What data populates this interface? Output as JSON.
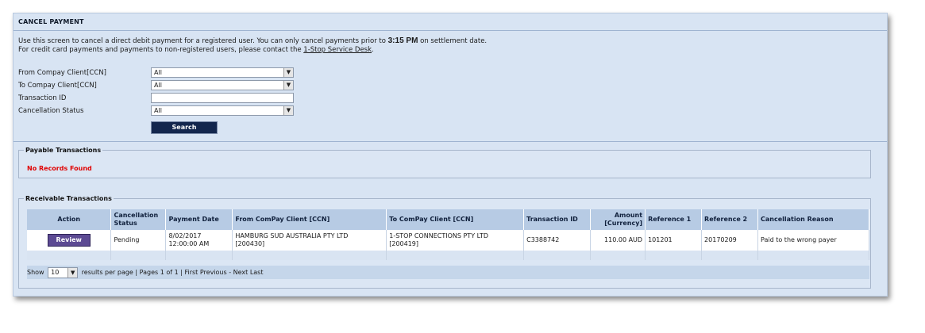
{
  "title": "CANCEL PAYMENT",
  "intro": {
    "line1_before": "Use this screen to cancel a direct debit payment for a registered user. You can only cancel payments prior to",
    "cutoff_time": "3:15 PM",
    "line1_after": "on settlement date.",
    "line2_before": "For credit card payments and payments to non-registered users, please contact the",
    "service_desk_link": "1-Stop Service Desk",
    "line2_after": "."
  },
  "filters": {
    "from_label": "From Compay Client[CCN]",
    "from_value": "All",
    "to_label": "To Compay Client[CCN]",
    "to_value": "All",
    "txn_label": "Transaction ID",
    "txn_value": "",
    "status_label": "Cancellation Status",
    "status_value": "All",
    "search_label": "Search"
  },
  "payable": {
    "legend": "Payable Transactions",
    "empty_message": "No Records Found"
  },
  "receivable": {
    "legend": "Receivable Transactions",
    "headers": {
      "action": "Action",
      "cancellation_status_1": "Cancellation",
      "cancellation_status_2": "Status",
      "payment_date": "Payment Date",
      "from_client": "From ComPay Client [CCN]",
      "to_client": "To ComPay Client [CCN]",
      "transaction_id": "Transaction ID",
      "amount_1": "Amount",
      "amount_2": "[Currency]",
      "reference1": "Reference 1",
      "reference2": "Reference 2",
      "cancellation_reason": "Cancellation Reason"
    },
    "rows": [
      {
        "action_label": "Review",
        "status": "Pending",
        "payment_date_1": "8/02/2017",
        "payment_date_2": "12:00:00 AM",
        "from_client_1": "HAMBURG SUD AUSTRALIA PTY LTD",
        "from_client_2": "[200430]",
        "to_client_1": "1-STOP CONNECTIONS PTY LTD",
        "to_client_2": "[200419]",
        "transaction_id": "C3388742",
        "amount": "110.00 AUD",
        "reference1": "101201",
        "reference2": "20170209",
        "reason": "Paid to the wrong payer"
      }
    ],
    "pager": {
      "show_label": "Show",
      "page_size": "10",
      "per_page_text": "results per page |",
      "pages_text": "Pages 1 of 1 |",
      "nav_text": "First Previous - Next Last"
    }
  }
}
